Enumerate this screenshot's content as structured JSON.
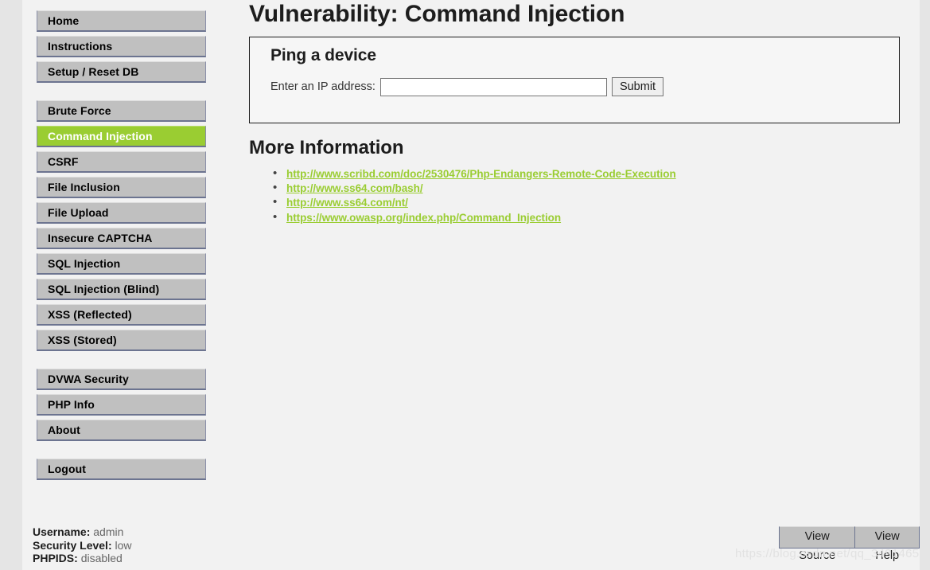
{
  "sidebar": {
    "groups": [
      {
        "name": "primary",
        "items": [
          {
            "label": "Home",
            "selected": false
          },
          {
            "label": "Instructions",
            "selected": false
          },
          {
            "label": "Setup / Reset DB",
            "selected": false
          }
        ]
      },
      {
        "name": "vulnerabilities",
        "items": [
          {
            "label": "Brute Force",
            "selected": false
          },
          {
            "label": "Command Injection",
            "selected": true
          },
          {
            "label": "CSRF",
            "selected": false
          },
          {
            "label": "File Inclusion",
            "selected": false
          },
          {
            "label": "File Upload",
            "selected": false
          },
          {
            "label": "Insecure CAPTCHA",
            "selected": false
          },
          {
            "label": "SQL Injection",
            "selected": false
          },
          {
            "label": "SQL Injection (Blind)",
            "selected": false
          },
          {
            "label": "XSS (Reflected)",
            "selected": false
          },
          {
            "label": "XSS (Stored)",
            "selected": false
          }
        ]
      },
      {
        "name": "meta",
        "items": [
          {
            "label": "DVWA Security",
            "selected": false
          },
          {
            "label": "PHP Info",
            "selected": false
          },
          {
            "label": "About",
            "selected": false
          }
        ]
      },
      {
        "name": "session",
        "items": [
          {
            "label": "Logout",
            "selected": false
          }
        ]
      }
    ]
  },
  "status": {
    "username_label": "Username:",
    "username_value": "admin",
    "security_level_label": "Security Level:",
    "security_level_value": "low",
    "phpids_label": "PHPIDS:",
    "phpids_value": "disabled"
  },
  "main": {
    "page_title": "Vulnerability: Command Injection",
    "panel": {
      "heading": "Ping a device",
      "field_label": "Enter an IP address:",
      "input_value": "",
      "input_placeholder": "",
      "submit_label": "Submit"
    },
    "more_information": {
      "heading": "More Information",
      "links": [
        "http://www.scribd.com/doc/2530476/Php-Endangers-Remote-Code-Execution",
        "http://www.ss64.com/bash/",
        "http://www.ss64.com/nt/",
        "https://www.owasp.org/index.php/Command_Injection"
      ]
    }
  },
  "footer_buttons": {
    "view_source": "View Source",
    "view_help": "View Help"
  },
  "watermark": "https://blog.csdn.net/qq_34914659",
  "colors": {
    "accent_green": "#9acd32",
    "nav_gray": "#c0c0c0",
    "page_bg": "#f2f2f2",
    "gutter_bg": "#e5e5e5",
    "text_dark": "#1d1d1d"
  }
}
